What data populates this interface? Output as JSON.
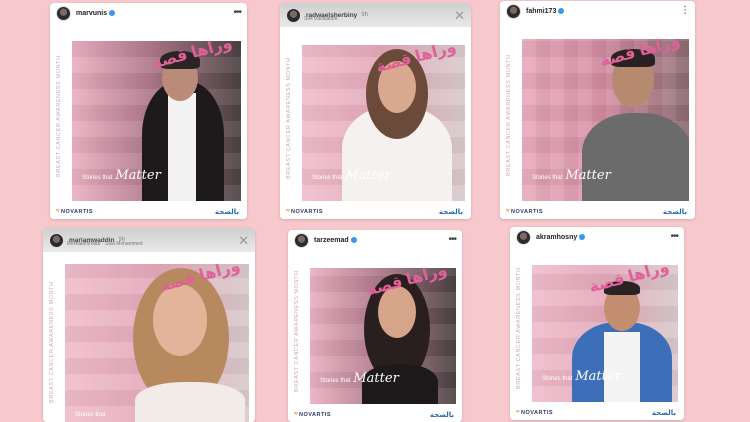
{
  "cards": [
    {
      "username": "marvunis",
      "verified": true,
      "kind": "post"
    },
    {
      "username": "radwaelsherbiny",
      "time": "9h",
      "subline": "See translation",
      "kind": "story"
    },
    {
      "username": "fahmi173",
      "verified": true,
      "kind": "post"
    },
    {
      "username": "mariamwaddin",
      "time": "9h",
      "subline": "therealamrdiab · Sala Mohammed",
      "kind": "story"
    },
    {
      "username": "tarzeemad",
      "verified": true,
      "kind": "post"
    },
    {
      "username": "akramhosny",
      "verified": true,
      "kind": "post"
    }
  ],
  "campaign": {
    "vertical_text": "BREAST CANCER AWARENESS MONTH",
    "tagline_prefix": "Stories that",
    "tagline_script": "Matter",
    "sponsor": "NOVARTIS",
    "arabic_logo": "وراها قصة",
    "partner_logo": "بالصحة"
  },
  "icons": {
    "more": "more-horizontal-icon",
    "close": "close-icon",
    "verified": "verified-badge-icon"
  },
  "colors": {
    "background": "#f7c9cd",
    "ribbon_pink": "#e0609a",
    "verified_blue": "#3897f0",
    "novartis_navy": "#2a3a6a"
  }
}
